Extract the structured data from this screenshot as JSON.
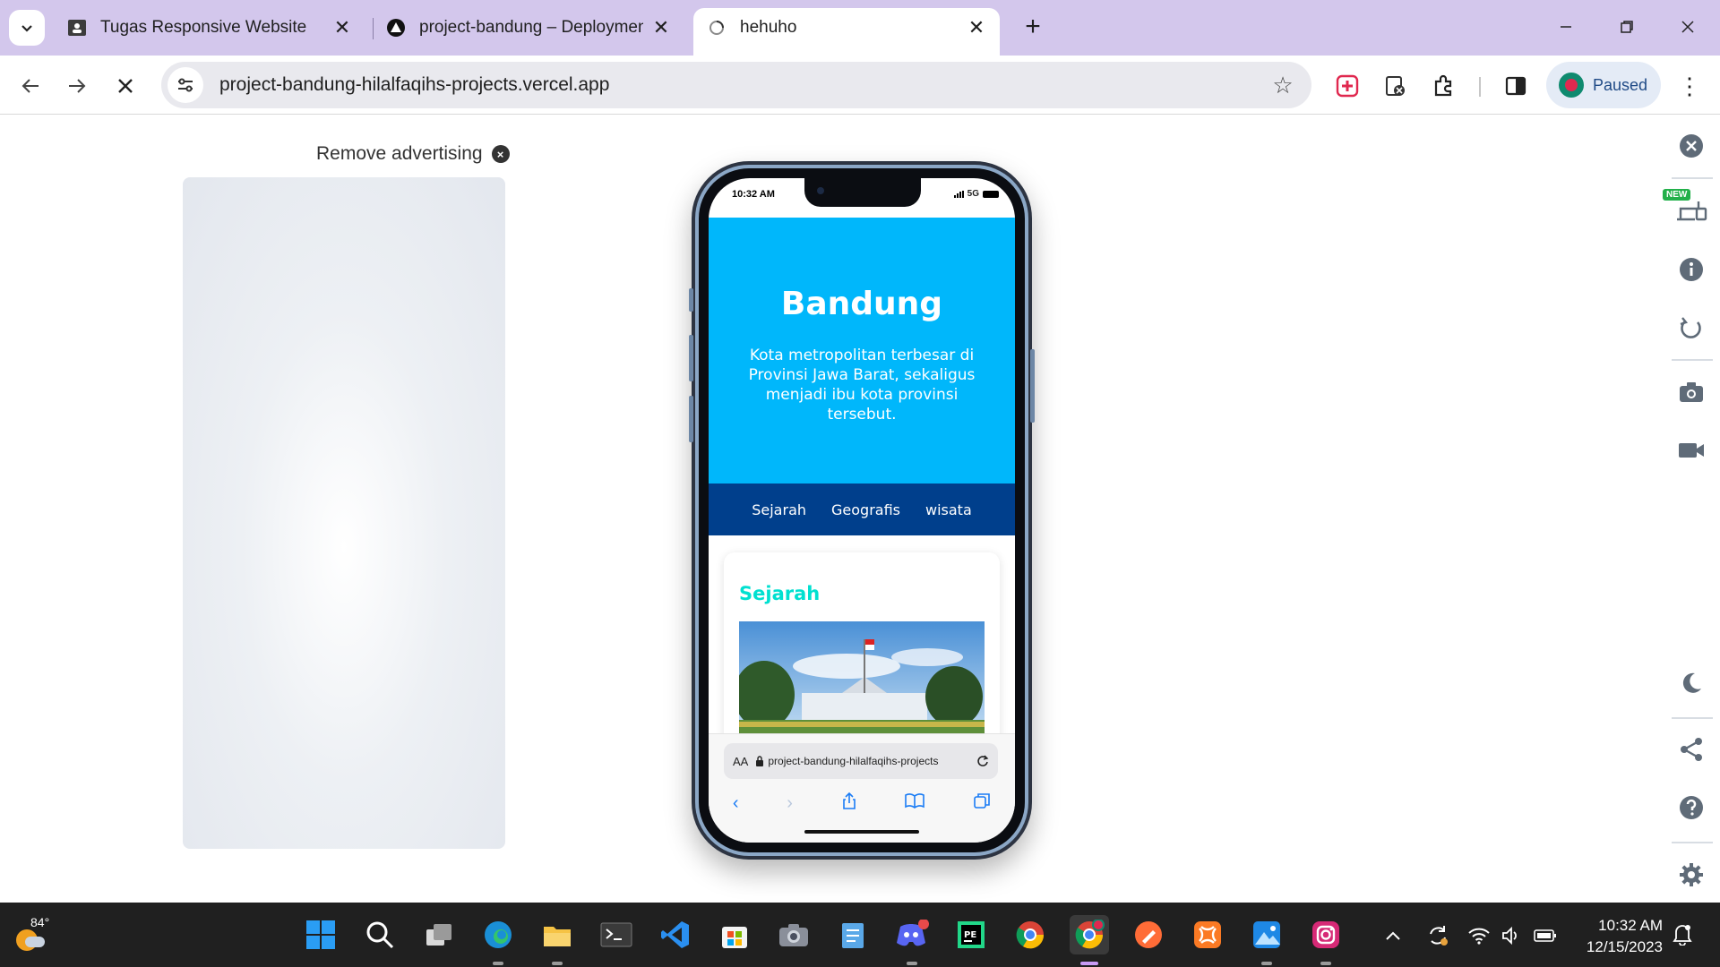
{
  "browser": {
    "tabs": [
      {
        "title": "Tugas Responsive Website",
        "favicon": "classroom-icon",
        "active": false
      },
      {
        "title": "project-bandung – Deployment",
        "favicon": "vercel-icon",
        "active": false
      },
      {
        "title": "hehuho",
        "favicon": "loading-globe-icon",
        "active": true
      }
    ],
    "url": "project-bandung-hilalfaqihs-projects.vercel.app",
    "profile_label": "Paused"
  },
  "page": {
    "ad_label": "Remove advertising",
    "ad_close": "×"
  },
  "phone": {
    "status_time": "10:32 AM",
    "network": "5G",
    "hero_title": "Bandung",
    "hero_text": "Kota metropolitan terbesar di Provinsi Jawa Barat, sekaligus menjadi ibu kota provinsi tersebut.",
    "nav": [
      "Sejarah",
      "Geografis",
      "wisata"
    ],
    "section_title": "Sejarah",
    "safari_aa": "AA",
    "safari_url": "project-bandung-hilalfaqihs-projects"
  },
  "sidebar": {
    "badge": "NEW"
  },
  "taskbar": {
    "weather_temp": "84°",
    "time": "10:32 AM",
    "date": "12/15/2023"
  },
  "colors": {
    "hero_bg": "#00b7fb",
    "subnav_bg": "#003f8c",
    "section_title": "#00e0d0",
    "tabstrip": "#d3c7ec"
  }
}
